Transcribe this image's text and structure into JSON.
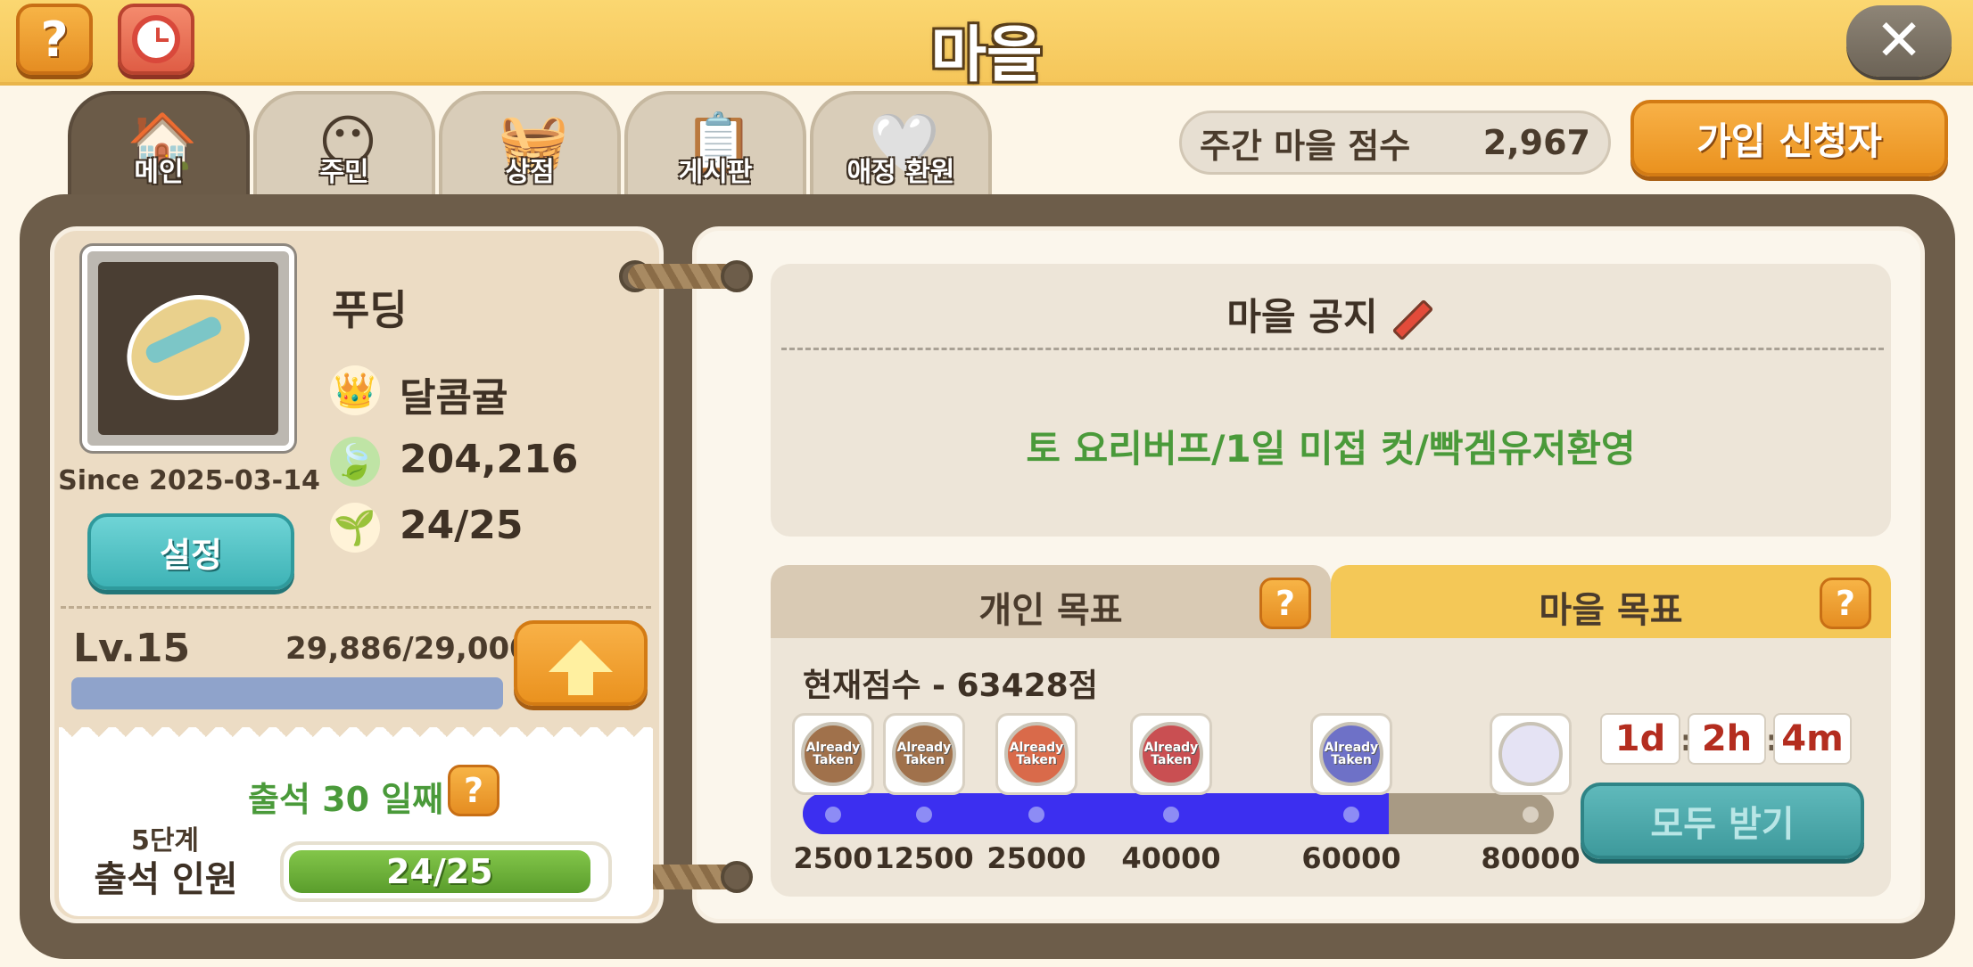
{
  "header": {
    "title": "마을",
    "help_label": "?"
  },
  "tabs": [
    {
      "label": "메인",
      "icon": "house-icon",
      "active": true
    },
    {
      "label": "주민",
      "icon": "resident-icon",
      "active": false
    },
    {
      "label": "상점",
      "icon": "basket-icon",
      "active": false
    },
    {
      "label": "게시판",
      "icon": "board-icon",
      "active": false
    },
    {
      "label": "애정 환원",
      "icon": "heart-icon",
      "active": false
    }
  ],
  "weekly_score": {
    "label": "주간 마을 점수",
    "value": "2,967"
  },
  "apply_button": "가입 신청자",
  "profile": {
    "name": "푸딩",
    "since": "Since 2025-03-14",
    "settings_button": "설정",
    "leader": "달콤귤",
    "leaves": "204,216",
    "members": "24/25",
    "level": "Lv.15",
    "exp": "29,886/29,000"
  },
  "attendance": {
    "days": "출석 30 일째",
    "help_label": "?",
    "stage": "5단계",
    "label": "출석 인원",
    "count": "24/25",
    "fraction": 0.96
  },
  "notice": {
    "title": "마을 공지",
    "text": "토 요리버프/1일 미접 컷/빡겜유저환영"
  },
  "goals": {
    "personal_tab": "개인 목표",
    "village_tab": "마을 목표",
    "help_label": "?",
    "current_score": "현재점수 - 63428점",
    "progress_fraction": 0.78,
    "milestones": [
      {
        "label": "2500",
        "badge": "Already Taken",
        "color": "#a0714b"
      },
      {
        "label": "12500",
        "badge": "Already Taken",
        "color": "#a0714b"
      },
      {
        "label": "25000",
        "badge": "Already Taken",
        "color": "#d96a4a"
      },
      {
        "label": "40000",
        "badge": "Already Taken",
        "color": "#c94f52"
      },
      {
        "label": "60000",
        "badge": "Already Taken",
        "color": "#6e71c7"
      },
      {
        "label": "80000",
        "badge": "",
        "color": "#e5e3f4"
      }
    ],
    "timer": {
      "days": "1d",
      "hours": "2h",
      "minutes": "4m",
      "sep": ":"
    },
    "receive_all_button": "모두 받기"
  }
}
